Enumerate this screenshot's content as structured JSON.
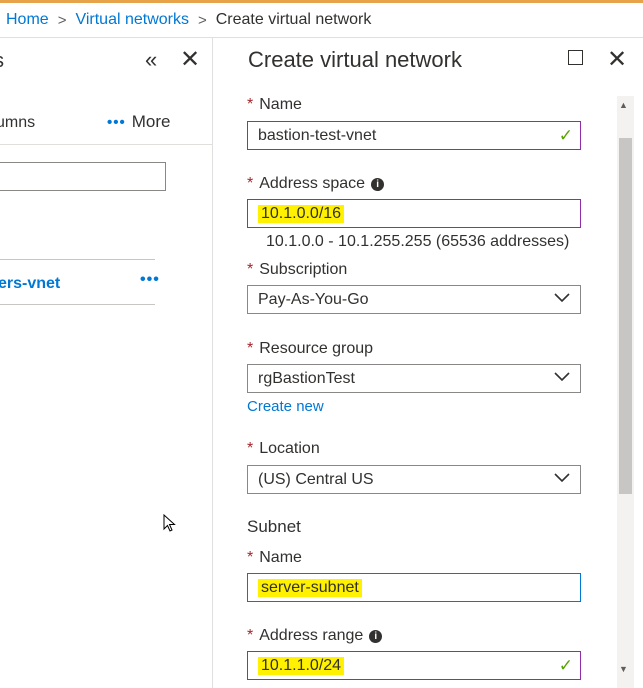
{
  "breadcrumb": {
    "items": [
      "Home",
      "Virtual networks"
    ],
    "current": "Create virtual network",
    "separator": ">"
  },
  "left_blade": {
    "title_fragment": "s",
    "collapse_glyph": "«",
    "close_glyph": "✕",
    "columns_fragment": "umns",
    "more_label": "More",
    "more_dots": "•••",
    "list_item_fragment": "ers-vnet",
    "list_item_dots": "•••"
  },
  "blade": {
    "title": "Create virtual network",
    "close_glyph": "✕"
  },
  "form": {
    "required_marker": "*",
    "name": {
      "label": "Name",
      "value": "bastion-test-vnet",
      "valid": "✓"
    },
    "address_space": {
      "label": "Address space",
      "value": "10.1.0.0/16",
      "hint": "10.1.0.0 - 10.1.255.255 (65536 addresses)"
    },
    "subscription": {
      "label": "Subscription",
      "value": "Pay-As-You-Go"
    },
    "resource_group": {
      "label": "Resource group",
      "value": "rgBastionTest",
      "create_new": "Create new"
    },
    "location": {
      "label": "Location",
      "value": "(US) Central US"
    },
    "subnet": {
      "heading": "Subnet",
      "name": {
        "label": "Name",
        "value": "server-subnet"
      },
      "address_range": {
        "label": "Address range",
        "value": "10.1.1.0/24",
        "valid": "✓"
      }
    },
    "info_glyph": "i"
  },
  "colors": {
    "link": "#0078d4",
    "required": "#a4262c",
    "valid_check": "#57a300",
    "highlight": "#fff100",
    "field_border_active": "#8f2ea8"
  }
}
